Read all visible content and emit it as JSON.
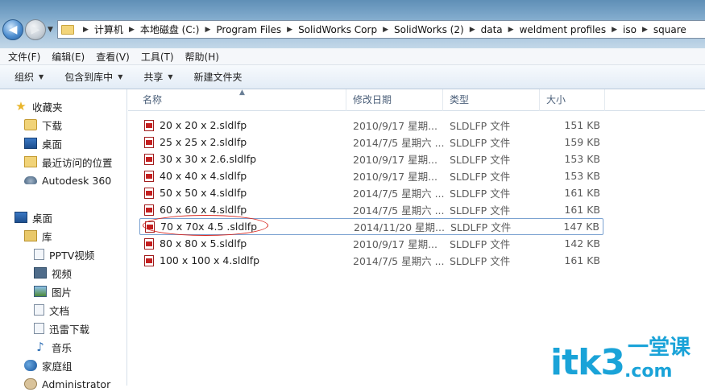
{
  "address_bar": {
    "crumbs": [
      "计算机",
      "本地磁盘 (C:)",
      "Program Files",
      "SolidWorks Corp",
      "SolidWorks (2)",
      "data",
      "weldment profiles",
      "iso",
      "square"
    ]
  },
  "menu": {
    "items": [
      "文件(F)",
      "编辑(E)",
      "查看(V)",
      "工具(T)",
      "帮助(H)"
    ]
  },
  "toolbar": {
    "organize": "组织",
    "include_library": "包含到库中",
    "share": "共享",
    "new_folder": "新建文件夹"
  },
  "nav": {
    "favorites": "收藏夹",
    "downloads": "下载",
    "desktop": "桌面",
    "recent": "最近访问的位置",
    "autodesk": "Autodesk 360",
    "desktop2": "桌面",
    "library": "库",
    "pptv": "PPTV视频",
    "video": "视频",
    "pictures": "图片",
    "documents": "文档",
    "xunlei": "迅雷下载",
    "music": "音乐",
    "homegroup": "家庭组",
    "admin": "Administrator"
  },
  "columns": {
    "name": "名称",
    "date": "修改日期",
    "type": "类型",
    "size": "大小"
  },
  "files": [
    {
      "name": "20 x 20 x 2.sldlfp",
      "date": "2010/9/17 星期...",
      "type": "SLDLFP 文件",
      "size": "151 KB"
    },
    {
      "name": "25 x 25 x 2.sldlfp",
      "date": "2014/7/5 星期六 ...",
      "type": "SLDLFP 文件",
      "size": "159 KB"
    },
    {
      "name": "30 x 30 x 2.6.sldlfp",
      "date": "2010/9/17 星期...",
      "type": "SLDLFP 文件",
      "size": "153 KB"
    },
    {
      "name": "40 x 40 x 4.sldlfp",
      "date": "2010/9/17 星期...",
      "type": "SLDLFP 文件",
      "size": "153 KB"
    },
    {
      "name": "50 x 50 x 4.sldlfp",
      "date": "2014/7/5 星期六 ...",
      "type": "SLDLFP 文件",
      "size": "161 KB"
    },
    {
      "name": "60 x 60 x 4.sldlfp",
      "date": "2014/7/5 星期六 ...",
      "type": "SLDLFP 文件",
      "size": "161 KB"
    },
    {
      "name": "70 x 70x 4.5 .sldlfp",
      "date": "2014/11/20 星期...",
      "type": "SLDLFP 文件",
      "size": "147 KB"
    },
    {
      "name": "80 x 80 x 5.sldlfp",
      "date": "2010/9/17 星期...",
      "type": "SLDLFP 文件",
      "size": "142 KB"
    },
    {
      "name": "100 x 100 x 4.sldlfp",
      "date": "2014/7/5 星期六 ...",
      "type": "SLDLFP 文件",
      "size": "161 KB"
    }
  ],
  "watermark": {
    "main": "itk3",
    "sub": "一堂课",
    "domain": ".com"
  }
}
